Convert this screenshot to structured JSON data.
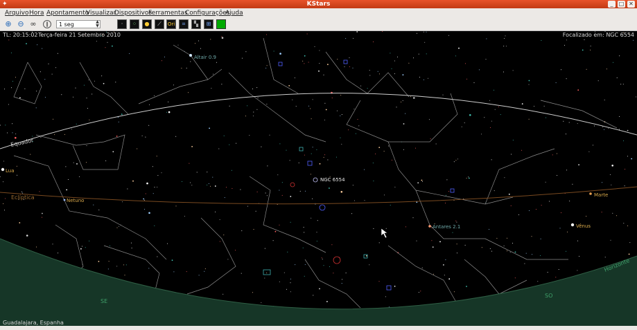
{
  "window": {
    "title": "KStars"
  },
  "menu": [
    "Arquivo",
    "Hora",
    "Apontamento",
    "Visualizar",
    "Dispositivos",
    "Ferramentas",
    "Configurações",
    "Ajuda"
  ],
  "toolbar": {
    "step_value": "1 seg"
  },
  "sky": {
    "time_label": "TL: 20:15:02",
    "date_label": "Terça-feira 21 Setembro 2010",
    "focus_label": "Focalizado em: NGC 6554",
    "location_label": "Guadalajara, Espanha",
    "labels": {
      "altair": "Altair 0.9",
      "equator": "Equador",
      "lua": "Lua",
      "ecliptic": "Eclíptica",
      "netuno": "Netuno",
      "ngc": "NGC 6554",
      "antares": "Antares 2.1",
      "marte": "Marte",
      "venus": "Vênus",
      "horizon": "Horizonte",
      "se": "SE",
      "so": "SO"
    },
    "colors": {
      "background": "#000000",
      "ground": "#163627",
      "equator": "#d0d0d0",
      "ecliptic": "#7a4a20",
      "constellation": "#9a9a9a",
      "planet_label": "#d9a94a",
      "star_label": "#6fa9a9"
    }
  }
}
